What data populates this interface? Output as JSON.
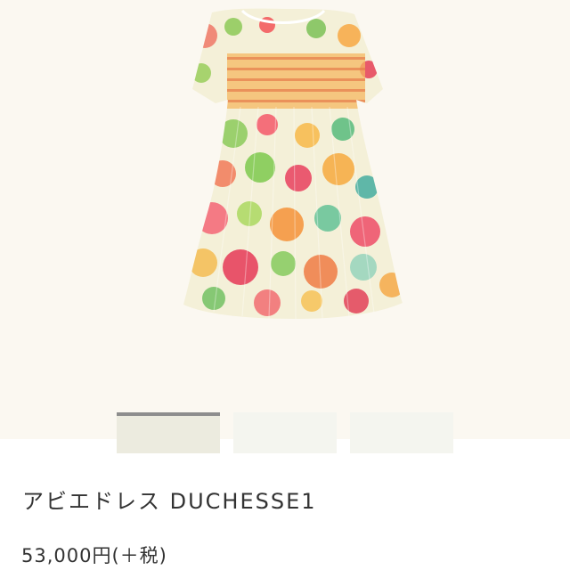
{
  "product": {
    "image_icon": "floral-dress-photo",
    "thumbnails": [
      {
        "name": "thumbnail-1",
        "selected": true
      },
      {
        "name": "thumbnail-2",
        "selected": false
      },
      {
        "name": "thumbnail-3",
        "selected": false
      }
    ],
    "title": "アビエドレス DUCHESSE1",
    "price": "53,000円(＋税)"
  }
}
